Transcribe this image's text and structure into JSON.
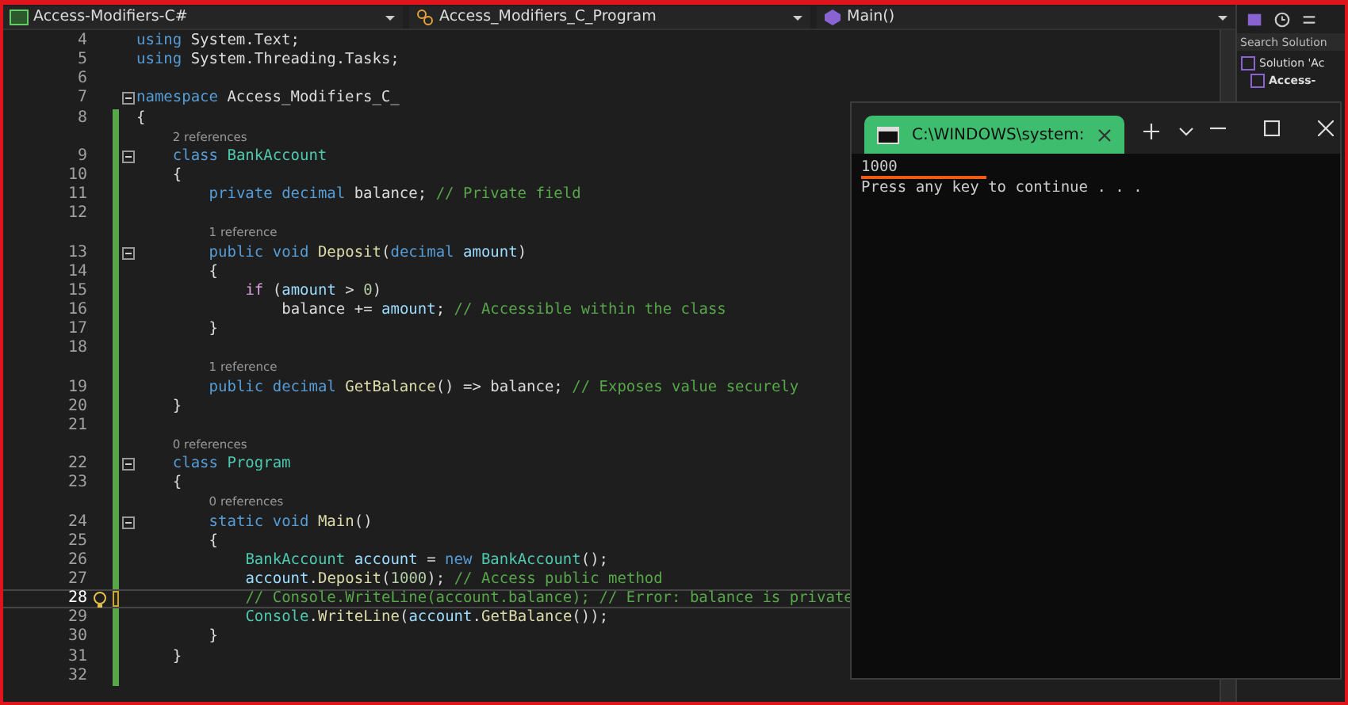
{
  "nav_bar": {
    "project": "Access-Modifiers-C#",
    "class": "Access_Modifiers_C_Program",
    "member": "Main()"
  },
  "code_lines": [
    {
      "kind": "code",
      "num": "4",
      "changed": false,
      "tokens": [
        {
          "kind": "keyword",
          "text": "using"
        },
        {
          "kind": "plain",
          "text": " System.Text;"
        }
      ]
    },
    {
      "kind": "code",
      "num": "5",
      "changed": false,
      "tokens": [
        {
          "kind": "keyword",
          "text": "using"
        },
        {
          "kind": "plain",
          "text": " System.Threading.Tasks;"
        }
      ]
    },
    {
      "kind": "code",
      "num": "6",
      "changed": false
    },
    {
      "kind": "code",
      "num": "7",
      "changed": false,
      "fold": true,
      "tokens": [
        {
          "kind": "keyword",
          "text": "namespace"
        },
        {
          "kind": "plain",
          "text": " Access_Modifiers_C_"
        }
      ]
    },
    {
      "kind": "code",
      "num": "8",
      "changed": true,
      "saved": true,
      "tokens": [
        {
          "kind": "plain",
          "text": "{"
        }
      ],
      "children": [
        {
          "kind": "lens",
          "changed": true,
          "saved": true,
          "text": "2 references"
        },
        {
          "kind": "code",
          "num": "9",
          "fold": true,
          "changed": true,
          "saved": true,
          "tokens": [
            {
              "kind": "keyword",
              "text": "class"
            },
            {
              "kind": "type",
              "text": " BankAccount"
            }
          ]
        },
        {
          "kind": "code",
          "num": "10",
          "changed": true,
          "saved": true,
          "tokens": [
            {
              "kind": "plain",
              "text": "{"
            }
          ],
          "children": [
            {
              "kind": "code",
              "num": "11",
              "changed": true,
              "saved": true,
              "tokens": [
                {
                  "kind": "keyword",
                  "text": "private"
                },
                {
                  "kind": "keyword",
                  "text": " decimal"
                },
                {
                  "kind": "plain",
                  "text": " balance; "
                },
                {
                  "kind": "comment",
                  "text": "// Private field"
                }
              ]
            },
            {
              "kind": "code",
              "num": "12",
              "changed": true,
              "saved": true
            },
            {
              "kind": "lens",
              "changed": true,
              "saved": true,
              "text": "1 reference"
            },
            {
              "kind": "code",
              "num": "13",
              "fold": true,
              "changed": true,
              "saved": true,
              "tokens": [
                {
                  "kind": "keyword",
                  "text": "public"
                },
                {
                  "kind": "keyword",
                  "text": " void"
                },
                {
                  "kind": "method",
                  "text": " Deposit"
                },
                {
                  "kind": "plain",
                  "text": "("
                },
                {
                  "kind": "keyword",
                  "text": "decimal"
                },
                {
                  "kind": "identifier",
                  "text": " amount"
                },
                {
                  "kind": "plain",
                  "text": ")"
                }
              ]
            },
            {
              "kind": "code",
              "num": "14",
              "changed": true,
              "saved": true,
              "tokens": [
                {
                  "kind": "plain",
                  "text": "{"
                }
              ],
              "children": [
                {
                  "kind": "code",
                  "num": "15",
                  "changed": true,
                  "saved": true,
                  "tokens": [
                    {
                      "kind": "control",
                      "text": "if"
                    },
                    {
                      "kind": "plain",
                      "text": " ("
                    },
                    {
                      "kind": "identifier",
                      "text": "amount"
                    },
                    {
                      "kind": "plain",
                      "text": " > "
                    },
                    {
                      "kind": "number",
                      "text": "0"
                    },
                    {
                      "kind": "plain",
                      "text": ")"
                    }
                  ],
                  "children": [
                    {
                      "kind": "code",
                      "num": "16",
                      "changed": true,
                      "saved": true,
                      "tokens": [
                        {
                          "kind": "plain",
                          "text": "balance += "
                        },
                        {
                          "kind": "identifier",
                          "text": "amount"
                        },
                        {
                          "kind": "plain",
                          "text": "; "
                        },
                        {
                          "kind": "comment",
                          "text": "// Accessible within the class"
                        }
                      ]
                    }
                  ]
                }
              ]
            },
            {
              "kind": "code",
              "num": "17",
              "changed": true,
              "saved": true,
              "tokens": [
                {
                  "kind": "plain",
                  "text": "}"
                }
              ]
            },
            {
              "kind": "code",
              "num": "18",
              "changed": true,
              "saved": true
            },
            {
              "kind": "lens",
              "changed": true,
              "saved": true,
              "text": "1 reference"
            },
            {
              "kind": "code",
              "num": "19",
              "changed": true,
              "saved": true,
              "tokens": [
                {
                  "kind": "keyword",
                  "text": "public"
                },
                {
                  "kind": "keyword",
                  "text": " decimal"
                },
                {
                  "kind": "method",
                  "text": " GetBalance"
                },
                {
                  "kind": "plain",
                  "text": "() => balance; "
                },
                {
                  "kind": "comment",
                  "text": "// Exposes value securely"
                }
              ]
            }
          ]
        },
        {
          "kind": "code",
          "num": "20",
          "changed": true,
          "saved": true,
          "tokens": [
            {
              "kind": "plain",
              "text": "}"
            }
          ]
        },
        {
          "kind": "code",
          "num": "21",
          "changed": true,
          "saved": true
        },
        {
          "kind": "lens",
          "changed": true,
          "saved": true,
          "text": "0 references"
        },
        {
          "kind": "code",
          "num": "22",
          "fold": true,
          "changed": true,
          "saved": true,
          "tokens": [
            {
              "kind": "keyword",
              "text": "class"
            },
            {
              "kind": "type",
              "text": " Program"
            }
          ]
        },
        {
          "kind": "code",
          "num": "23",
          "changed": true,
          "saved": true,
          "tokens": [
            {
              "kind": "plain",
              "text": "{"
            }
          ],
          "children": [
            {
              "kind": "lens",
              "changed": true,
              "saved": true,
              "text": "0 references"
            },
            {
              "kind": "code",
              "num": "24",
              "fold": true,
              "changed": true,
              "saved": true,
              "tokens": [
                {
                  "kind": "keyword",
                  "text": "static"
                },
                {
                  "kind": "keyword",
                  "text": " void"
                },
                {
                  "kind": "method",
                  "text": " Main"
                },
                {
                  "kind": "plain",
                  "text": "()"
                }
              ]
            },
            {
              "kind": "code",
              "num": "25",
              "changed": true,
              "saved": true,
              "tokens": [
                {
                  "kind": "plain",
                  "text": "{"
                }
              ],
              "children": [
                {
                  "kind": "code",
                  "num": "26",
                  "changed": true,
                  "saved": true,
                  "tokens": [
                    {
                      "kind": "type",
                      "text": "BankAccount"
                    },
                    {
                      "kind": "identifier",
                      "text": " account"
                    },
                    {
                      "kind": "plain",
                      "text": " = "
                    },
                    {
                      "kind": "keyword",
                      "text": "new"
                    },
                    {
                      "kind": "type",
                      "text": " BankAccount"
                    },
                    {
                      "kind": "plain",
                      "text": "();"
                    }
                  ]
                },
                {
                  "kind": "code",
                  "num": "27",
                  "changed": true,
                  "saved": true,
                  "tokens": [
                    {
                      "kind": "identifier",
                      "text": "account"
                    },
                    {
                      "kind": "plain",
                      "text": "."
                    },
                    {
                      "kind": "method",
                      "text": "Deposit"
                    },
                    {
                      "kind": "plain",
                      "text": "("
                    },
                    {
                      "kind": "number",
                      "text": "1000"
                    },
                    {
                      "kind": "plain",
                      "text": "); "
                    },
                    {
                      "kind": "comment",
                      "text": "// Access public method"
                    }
                  ]
                },
                {
                  "kind": "code",
                  "num": "28",
                  "current": true,
                  "changed": true,
                  "saved": false,
                  "tokens": [
                    {
                      "kind": "comment",
                      "text": "// Console.WriteLine(account.balance); // Error: balance is private"
                    }
                  ]
                },
                {
                  "kind": "code",
                  "num": "29",
                  "changed": true,
                  "saved": true,
                  "tokens": [
                    {
                      "kind": "type",
                      "text": "Console"
                    },
                    {
                      "kind": "plain",
                      "text": "."
                    },
                    {
                      "kind": "method",
                      "text": "WriteLine"
                    },
                    {
                      "kind": "plain",
                      "text": "("
                    },
                    {
                      "kind": "identifier",
                      "text": "account"
                    },
                    {
                      "kind": "plain",
                      "text": "."
                    },
                    {
                      "kind": "method",
                      "text": "GetBalance"
                    },
                    {
                      "kind": "plain",
                      "text": "());"
                    }
                  ]
                }
              ]
            },
            {
              "kind": "code",
              "num": "30",
              "changed": true,
              "saved": true,
              "tokens": [
                {
                  "kind": "plain",
                  "text": "}"
                }
              ]
            }
          ]
        },
        {
          "kind": "code",
          "num": "31",
          "changed": true,
          "saved": true,
          "tokens": [
            {
              "kind": "plain",
              "text": "}"
            }
          ]
        }
      ]
    },
    {
      "kind": "code",
      "num": "32",
      "changed": true,
      "saved": true
    }
  ],
  "solution_explorer": {
    "search": {
      "placeholder": "Search Solution"
    },
    "items": [
      {
        "label": "Solution 'Ac",
        "bold": false
      },
      {
        "label": "Access-",
        "bold": true
      }
    ]
  },
  "console": {
    "tab": {
      "title": "C:\\WINDOWS\\system:",
      "selected": true
    },
    "output": [
      {
        "text": "1000",
        "underlined": true
      },
      {
        "text": "Press any key to continue . . .",
        "underlined": false
      }
    ]
  }
}
